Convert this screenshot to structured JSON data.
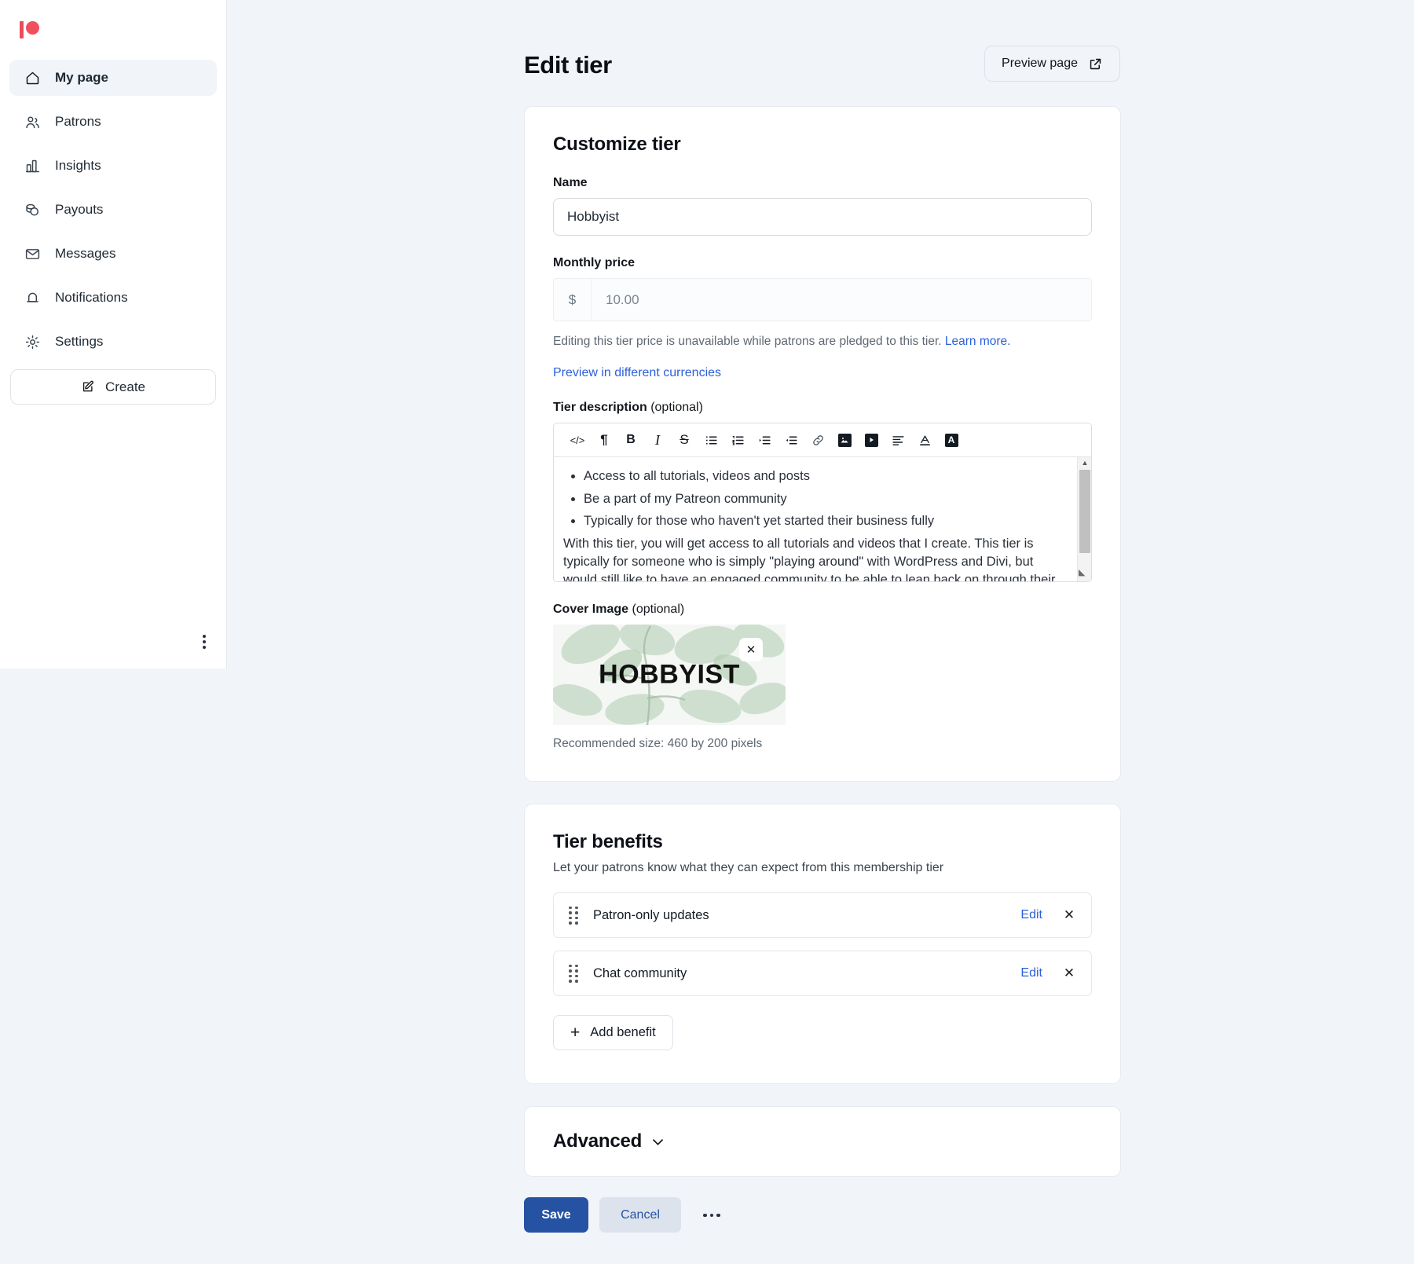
{
  "brand": {
    "logo_name": "patreon-logo",
    "accent": "#f0505e"
  },
  "sidebar": {
    "items": [
      {
        "label": "My page",
        "icon": "home-icon",
        "active": true
      },
      {
        "label": "Patrons",
        "icon": "people-icon",
        "active": false
      },
      {
        "label": "Insights",
        "icon": "bar-chart-icon",
        "active": false
      },
      {
        "label": "Payouts",
        "icon": "coins-icon",
        "active": false
      },
      {
        "label": "Messages",
        "icon": "envelope-icon",
        "active": false
      },
      {
        "label": "Notifications",
        "icon": "bell-icon",
        "active": false
      },
      {
        "label": "Settings",
        "icon": "gear-icon",
        "active": false
      }
    ],
    "create_label": "Create",
    "more_icon": "more-vertical-icon"
  },
  "header": {
    "title": "Edit tier",
    "preview_label": "Preview page",
    "preview_icon": "external-link-icon"
  },
  "customize": {
    "title": "Customize tier",
    "name_label": "Name",
    "name_value": "Hobbyist",
    "price_label": "Monthly price",
    "currency_symbol": "$",
    "price_value": "10.00",
    "price_helper": "Editing this tier price is unavailable while patrons are pledged to this tier.",
    "price_helper_link": "Learn more.",
    "currency_preview_link": "Preview in different currencies",
    "description_label": "Tier description",
    "description_optional": "(optional)",
    "toolbar": [
      {
        "name": "code-block-icon",
        "glyph": "</>"
      },
      {
        "name": "paragraph-icon",
        "glyph": "¶"
      },
      {
        "name": "bold-icon",
        "glyph": "B"
      },
      {
        "name": "italic-icon",
        "glyph": "I"
      },
      {
        "name": "strikethrough-icon",
        "glyph": "S"
      },
      {
        "name": "bullet-list-icon",
        "glyph": ""
      },
      {
        "name": "numbered-list-icon",
        "glyph": ""
      },
      {
        "name": "indent-icon",
        "glyph": ""
      },
      {
        "name": "outdent-icon",
        "glyph": ""
      },
      {
        "name": "link-icon",
        "glyph": ""
      },
      {
        "name": "image-icon",
        "glyph": ""
      },
      {
        "name": "video-icon",
        "glyph": ""
      },
      {
        "name": "align-left-icon",
        "glyph": ""
      },
      {
        "name": "text-color-icon",
        "glyph": "A"
      },
      {
        "name": "highlight-color-icon",
        "glyph": "A"
      }
    ],
    "description_bullets": [
      "Access to all tutorials, videos and posts",
      "Be a part of my Patreon community",
      "Typically for those who haven't yet started their business fully"
    ],
    "description_paragraph": "With this tier, you will get access to all tutorials and videos that I create. This tier is typically for someone who is simply \"playing around\" with WordPress and Divi, but would still like to have an engaged community to be able to lean back on through their journey.",
    "cover_label": "Cover Image",
    "cover_optional": "(optional)",
    "cover_image_text": "HOBBYIST",
    "cover_remove_icon": "close-icon",
    "cover_recommended": "Recommended size: 460 by 200 pixels"
  },
  "benefits": {
    "title": "Tier benefits",
    "subtitle": "Let your patrons know what they can expect from this membership tier",
    "items": [
      {
        "name": "Patron-only updates",
        "edit_label": "Edit",
        "remove_icon": "close-icon"
      },
      {
        "name": "Chat community",
        "edit_label": "Edit",
        "remove_icon": "close-icon"
      }
    ],
    "add_label": "Add benefit",
    "add_icon": "plus-icon"
  },
  "advanced": {
    "title": "Advanced",
    "chevron_icon": "chevron-down-icon"
  },
  "actions": {
    "save_label": "Save",
    "cancel_label": "Cancel",
    "more_icon": "more-horizontal-icon"
  }
}
